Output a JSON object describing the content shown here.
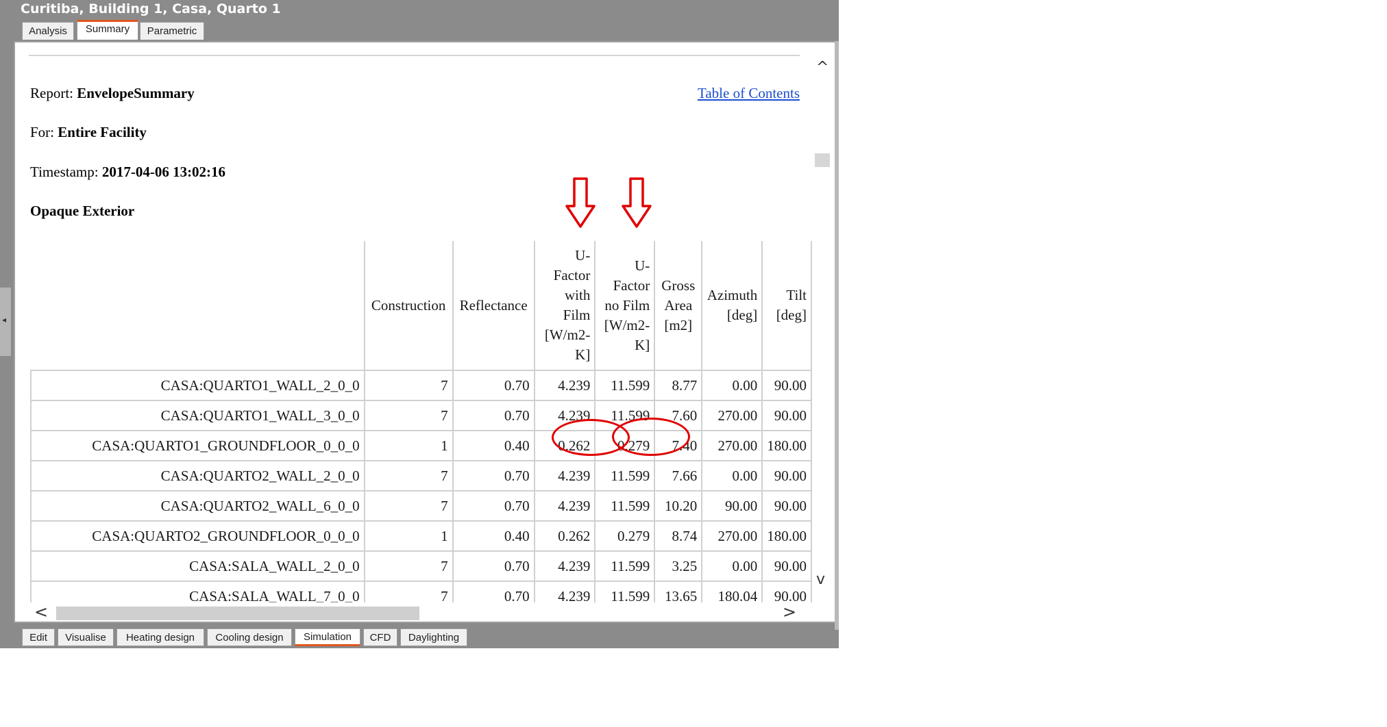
{
  "window": {
    "title": "Curitiba, Building 1, Casa, Quarto 1"
  },
  "top_tabs": [
    {
      "label": "Analysis",
      "active": false
    },
    {
      "label": "Summary",
      "active": true
    },
    {
      "label": "Parametric",
      "active": false
    }
  ],
  "report": {
    "report_label": "Report:",
    "report_value": "EnvelopeSummary",
    "for_label": "For:",
    "for_value": "Entire Facility",
    "timestamp_label": "Timestamp:",
    "timestamp_value": "2017-04-06 13:02:16",
    "toc_link": "Table of Contents",
    "section_title": "Opaque Exterior"
  },
  "table": {
    "columns": [
      "",
      "Construction",
      "Reflectance",
      "U-Factor with Film [W/m2-K]",
      "U-Factor no Film [W/m2-K]",
      "Gross Area [m2]",
      "Azimuth [deg]",
      "Tilt [deg]"
    ],
    "rows": [
      [
        "CASA:QUARTO1_WALL_2_0_0",
        "7",
        "0.70",
        "4.239",
        "11.599",
        "8.77",
        "0.00",
        "90.00"
      ],
      [
        "CASA:QUARTO1_WALL_3_0_0",
        "7",
        "0.70",
        "4.239",
        "11.599",
        "7.60",
        "270.00",
        "90.00"
      ],
      [
        "CASA:QUARTO1_GROUNDFLOOR_0_0_0",
        "1",
        "0.40",
        "0.262",
        "0.279",
        "7.40",
        "270.00",
        "180.00"
      ],
      [
        "CASA:QUARTO2_WALL_2_0_0",
        "7",
        "0.70",
        "4.239",
        "11.599",
        "7.66",
        "0.00",
        "90.00"
      ],
      [
        "CASA:QUARTO2_WALL_6_0_0",
        "7",
        "0.70",
        "4.239",
        "11.599",
        "10.20",
        "90.00",
        "90.00"
      ],
      [
        "CASA:QUARTO2_GROUNDFLOOR_0_0_0",
        "1",
        "0.40",
        "0.262",
        "0.279",
        "8.74",
        "270.00",
        "180.00"
      ],
      [
        "CASA:SALA_WALL_2_0_0",
        "7",
        "0.70",
        "4.239",
        "11.599",
        "3.25",
        "0.00",
        "90.00"
      ],
      [
        "CASA:SALA_WALL_7_0_0",
        "7",
        "0.70",
        "4.239",
        "11.599",
        "13.65",
        "180.04",
        "90.00"
      ]
    ]
  },
  "annotations": {
    "color": "#e00000",
    "arrow_icon": "down-arrow-outline-icon",
    "circle_icon": "ellipse-highlight"
  },
  "bottom_tabs": [
    {
      "label": "Edit",
      "active": false
    },
    {
      "label": "Visualise",
      "active": false
    },
    {
      "label": "Heating design",
      "active": false
    },
    {
      "label": "Cooling design",
      "active": false
    },
    {
      "label": "Simulation",
      "active": true
    },
    {
      "label": "CFD",
      "active": false
    },
    {
      "label": "Daylighting",
      "active": false
    }
  ],
  "scrollbars": {
    "up": "^",
    "down": "v",
    "left": "<",
    "right": ">"
  },
  "colors": {
    "accent": "#e0561f",
    "link": "#1a4fd0",
    "chrome": "#8b8b8b"
  }
}
